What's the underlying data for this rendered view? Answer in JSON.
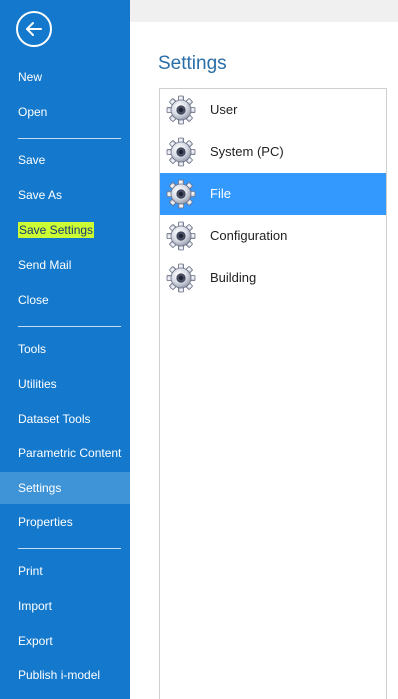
{
  "nav": {
    "back_icon": "arrow-left-circle-icon",
    "items_group1": [
      {
        "label": "New"
      },
      {
        "label": "Open"
      }
    ],
    "items_group2": [
      {
        "label": "Save"
      },
      {
        "label": "Save As"
      },
      {
        "label": "Save Settings",
        "highlighted": true
      },
      {
        "label": "Send Mail"
      },
      {
        "label": "Close"
      }
    ],
    "items_group3": [
      {
        "label": "Tools"
      },
      {
        "label": "Utilities"
      },
      {
        "label": "Dataset Tools"
      },
      {
        "label": "Parametric Content"
      },
      {
        "label": "Settings",
        "selected": true
      },
      {
        "label": "Properties"
      }
    ],
    "items_group4": [
      {
        "label": "Print"
      },
      {
        "label": "Import"
      },
      {
        "label": "Export"
      },
      {
        "label": "Publish i-model"
      }
    ]
  },
  "settings": {
    "title": "Settings",
    "items": [
      {
        "label": "User",
        "icon": "gear-icon"
      },
      {
        "label": "System (PC)",
        "icon": "gear-icon"
      },
      {
        "label": "File",
        "icon": "gear-icon",
        "selected": true
      },
      {
        "label": "Configuration",
        "icon": "gear-icon"
      },
      {
        "label": "Building",
        "icon": "gear-icon"
      }
    ]
  },
  "colors": {
    "nav_background": "#1479cc",
    "nav_selected": "#3f94d8",
    "list_selected": "#3399ff",
    "title_color": "#2a6ea8",
    "highlighter": "#ccff33"
  }
}
